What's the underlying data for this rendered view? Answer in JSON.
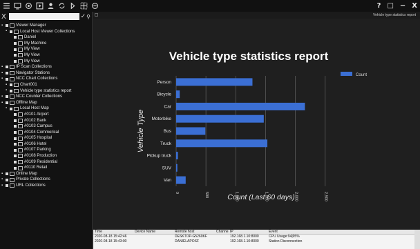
{
  "toolbar": {
    "icons": [
      "menu-icon",
      "monitor-icon",
      "camera-icon",
      "playback-icon",
      "user-icon",
      "sync-icon",
      "arrow-icon",
      "map-add-icon",
      "layout-icon"
    ],
    "window_controls": [
      "?",
      "□",
      "−",
      "X"
    ]
  },
  "sidebar": {
    "search_close": "X",
    "search_placeholder": "",
    "search_check": "✓",
    "search_icon": "⚲",
    "items": [
      {
        "label": "Viewer Manager",
        "level": 1
      },
      {
        "label": "Local Host Viewer Collections",
        "level": 2
      },
      {
        "label": "Daniel",
        "level": 3
      },
      {
        "label": "My Machine",
        "level": 3
      },
      {
        "label": "My View",
        "level": 3
      },
      {
        "label": "My View",
        "level": 3
      },
      {
        "label": "My View",
        "level": 3
      },
      {
        "label": "IP Scan Collections",
        "level": 1
      },
      {
        "label": "Navigator Stations",
        "level": 1
      },
      {
        "label": "NCC Chart Collections",
        "level": 1
      },
      {
        "label": "Chart001",
        "level": 2
      },
      {
        "label": "Vehicle type statistics report",
        "level": 2
      },
      {
        "label": "NCC Counter Collections",
        "level": 1
      },
      {
        "label": "Offline Map",
        "level": 1
      },
      {
        "label": "Local Host Map",
        "level": 2
      },
      {
        "label": "#0101 Airport",
        "level": 3
      },
      {
        "label": "#0102 Bank",
        "level": 3
      },
      {
        "label": "#0103 Campus",
        "level": 3
      },
      {
        "label": "#0104 Commerical",
        "level": 3
      },
      {
        "label": "#0105 Hospital",
        "level": 3
      },
      {
        "label": "#0106 Hotel",
        "level": 3
      },
      {
        "label": "#0107 Parking",
        "level": 3
      },
      {
        "label": "#0108 Production",
        "level": 3
      },
      {
        "label": "#0109 Residential",
        "level": 3
      },
      {
        "label": "#0110 Retail",
        "level": 3
      },
      {
        "label": "Online Map",
        "level": 1
      },
      {
        "label": "Private Collections",
        "level": 1
      },
      {
        "label": "URL Collections",
        "level": 1
      }
    ]
  },
  "chart_panel": {
    "tab_title": "Vehicle type statistics report"
  },
  "chart_data": {
    "type": "bar",
    "orientation": "horizontal",
    "title": "Vehicle type statistics report",
    "xlabel": "Count (Last 60 days)",
    "ylabel": "Vehicle Type",
    "categories": [
      "Person",
      "Bicycle",
      "Car",
      "Motorbike",
      "Bus",
      "Truck",
      "Pickup truck",
      "SUV",
      "Van"
    ],
    "series": [
      {
        "name": "Count",
        "values": [
          1280,
          60,
          2160,
          1470,
          490,
          1530,
          30,
          20,
          160
        ]
      }
    ],
    "xlim": [
      0,
      2700
    ],
    "xticks": [
      0,
      500,
      1000,
      1500,
      2000,
      2500
    ],
    "xtick_labels": [
      "0",
      "500",
      "1,000",
      "1,500",
      "2,000",
      "2,500"
    ],
    "grid": true,
    "legend": "top-right",
    "bar_color": "#3b6fd4"
  },
  "events": {
    "headers": [
      "Time",
      "Device Name",
      "Remote host",
      "Channe...",
      "IP",
      "Event"
    ],
    "rows": [
      [
        "2020-08-18 15:42:46",
        "",
        "DESKTOP-G5260KF",
        "",
        "192.168.1.10:8000",
        "CPU Usage:94|95%"
      ],
      [
        "2020-08-18 15:43:00",
        "",
        "DANIELAPOSF",
        "",
        "192.168.1.10:8000",
        "Station Disconnection"
      ]
    ]
  }
}
